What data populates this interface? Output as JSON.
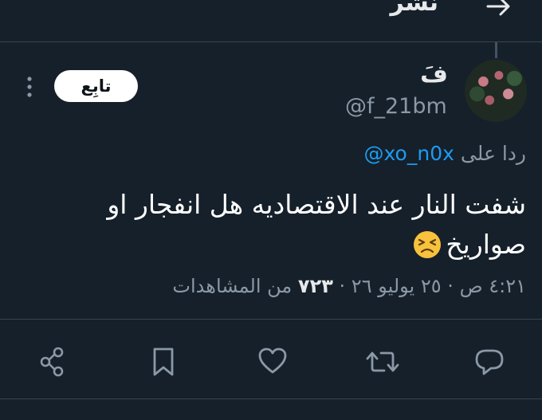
{
  "header": {
    "title": "نشر",
    "back_icon": "arrow-right-icon"
  },
  "tweet": {
    "author": {
      "display_name": "فَ",
      "handle": "@f_21bm",
      "avatar_icon": "avatar-image"
    },
    "follow_label": "تابِع",
    "more_icon": "more-vertical-icon",
    "reply_prefix": "ردا على",
    "reply_mention": "@xo_n0x",
    "text": "شفت النار عند الاقتصاديه هل انفجار او صواريخ",
    "emoji": "persevering-face-emoji",
    "time": "٤:٢١ ص",
    "date": "٢٥ يوليو ٢٦",
    "views_count": "٧٢٣",
    "views_label": "من المشاهدات",
    "separator": "·"
  },
  "actions": [
    {
      "name": "reply-icon"
    },
    {
      "name": "retweet-icon"
    },
    {
      "name": "like-icon"
    },
    {
      "name": "bookmark-icon"
    },
    {
      "name": "share-icon"
    }
  ],
  "colors": {
    "background": "#15202b",
    "accent": "#1d9bf0",
    "secondary_text": "#8b98a5",
    "divider": "#38444d"
  }
}
